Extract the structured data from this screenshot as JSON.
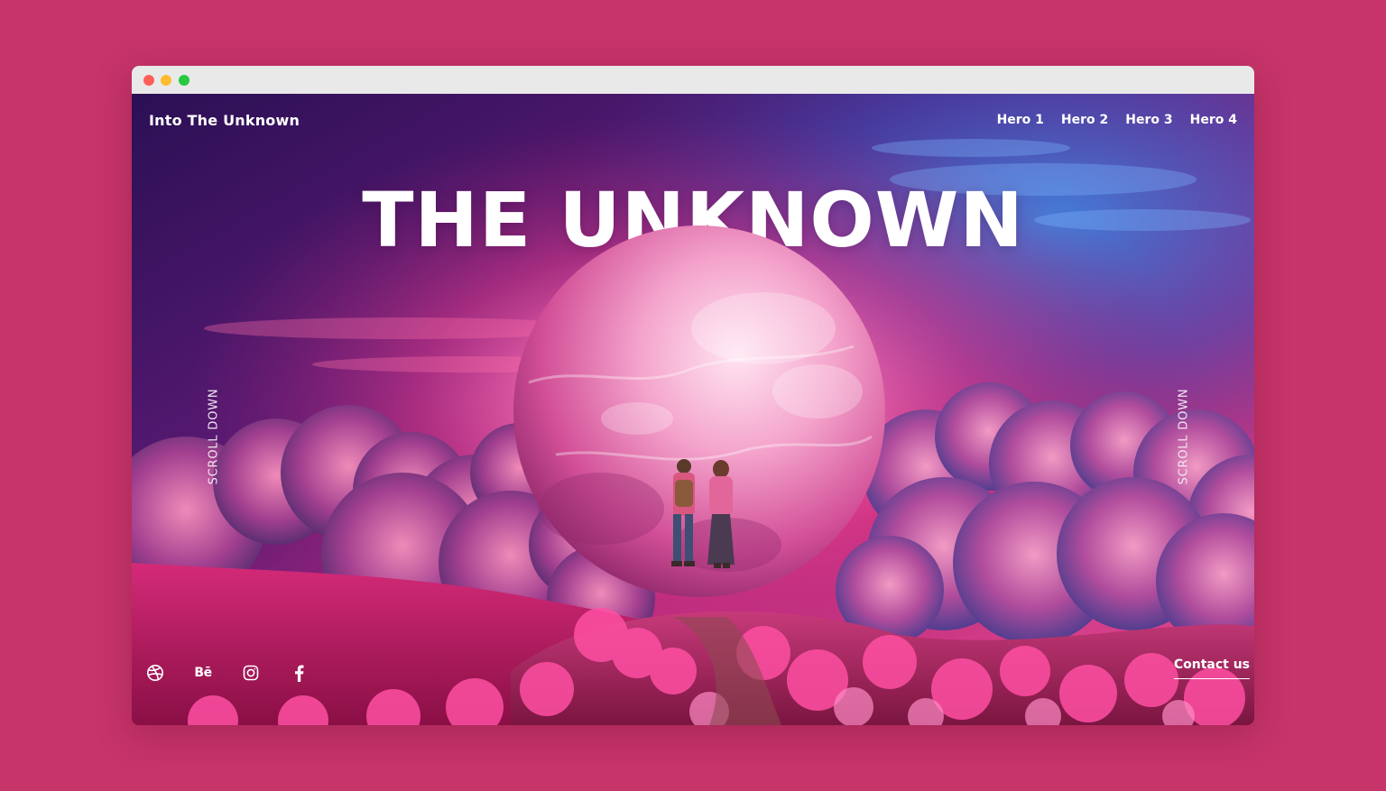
{
  "page": {
    "background_color": "#c6346a"
  },
  "window": {
    "controls": [
      {
        "name": "close",
        "color": "#ff5f57"
      },
      {
        "name": "minimize",
        "color": "#febc2e"
      },
      {
        "name": "maximize",
        "color": "#28c840"
      }
    ]
  },
  "header": {
    "brand": "Into The Unknown",
    "nav": [
      "Hero 1",
      "Hero 2",
      "Hero 3",
      "Hero 4"
    ]
  },
  "hero": {
    "title": "THE UNKNOWN",
    "scroll_left": "SCROLL DOWN",
    "scroll_right": "SCROLL DOWN"
  },
  "socials": [
    {
      "icon": "dribbble-icon"
    },
    {
      "icon": "behance-icon",
      "text": "Bē"
    },
    {
      "icon": "instagram-icon"
    },
    {
      "icon": "facebook-icon"
    }
  ],
  "cta": {
    "contact_label": "Contact us"
  }
}
